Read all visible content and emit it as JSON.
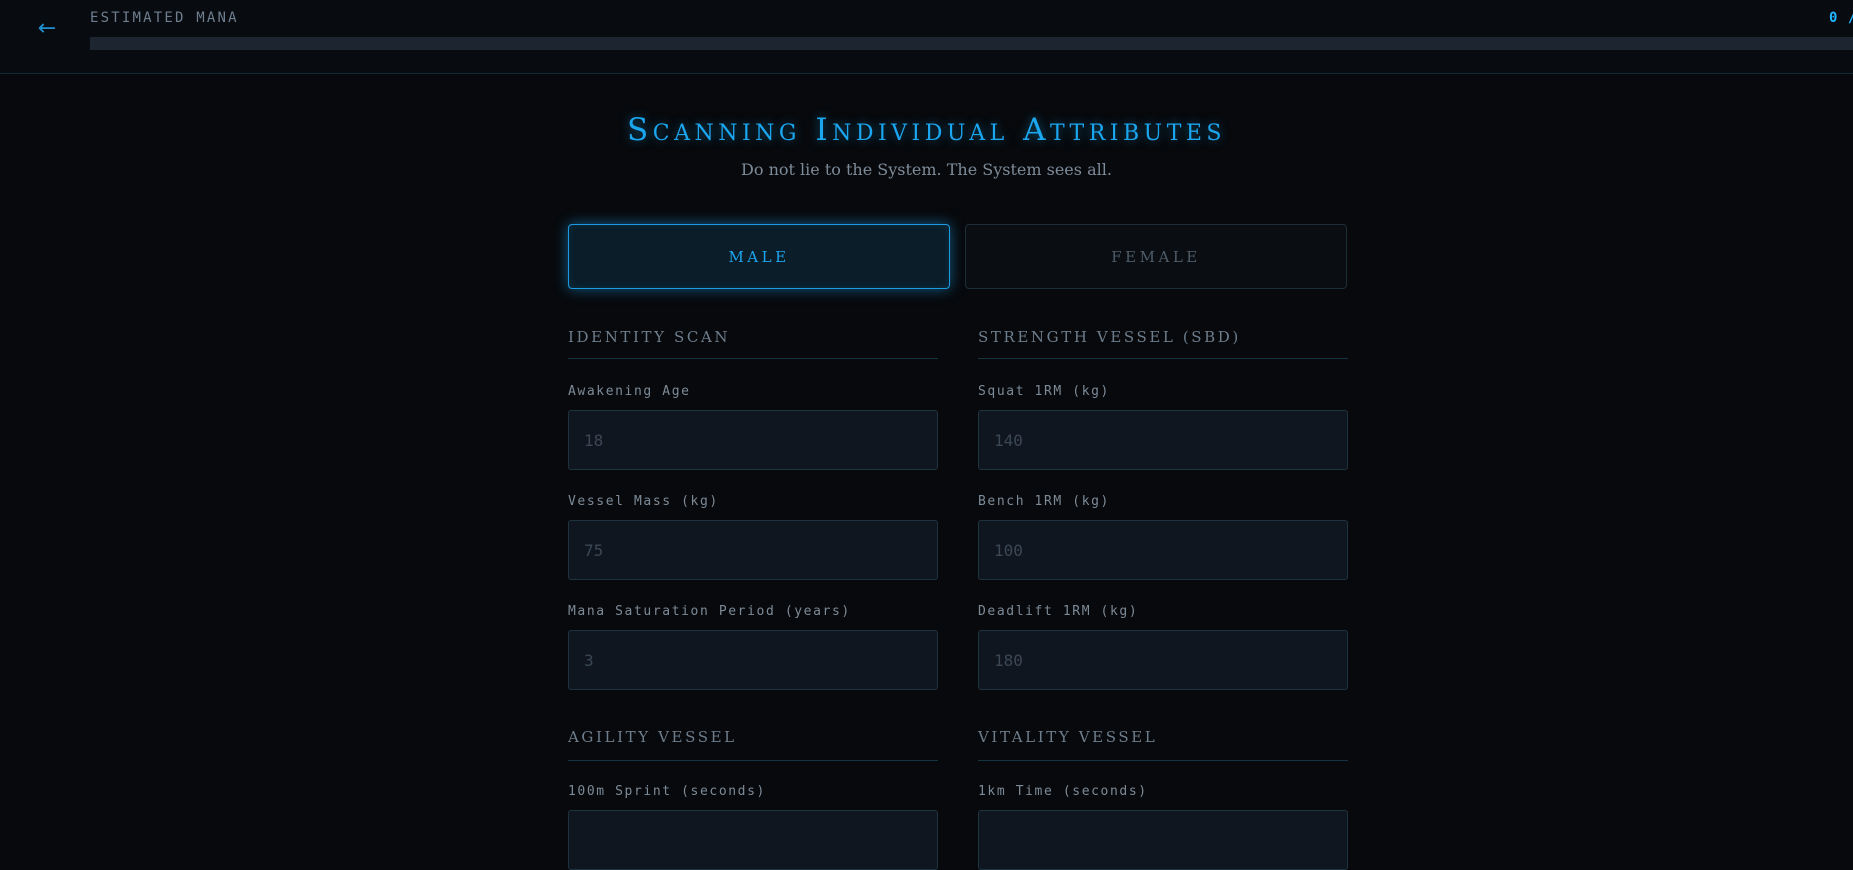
{
  "header": {
    "back_glyph": "←",
    "mana_label": "ESTIMATED MANA",
    "mana_value": "0 /",
    "mana_progress": 0
  },
  "title": "Scanning Individual Attributes",
  "subtitle": "Do not lie to the System. The System sees all.",
  "gender": {
    "male_label": "MALE",
    "female_label": "FEMALE",
    "selected": "MALE"
  },
  "sections": {
    "identity": {
      "title": "IDENTITY SCAN",
      "age": {
        "label": "Awakening Age",
        "value": "",
        "placeholder": "18"
      },
      "mass": {
        "label": "Vessel Mass (kg)",
        "value": "",
        "placeholder": "75"
      },
      "period": {
        "label": "Mana Saturation Period (years)",
        "value": "",
        "placeholder": "3"
      }
    },
    "strength": {
      "title": "STRENGTH VESSEL (SBD)",
      "squat": {
        "label": "Squat 1RM (kg)",
        "value": "",
        "placeholder": "140"
      },
      "bench": {
        "label": "Bench 1RM (kg)",
        "value": "",
        "placeholder": "100"
      },
      "deadlift": {
        "label": "Deadlift 1RM (kg)",
        "value": "",
        "placeholder": "180"
      }
    },
    "agility": {
      "title": "AGILITY VESSEL",
      "sprint": {
        "label": "100m Sprint (seconds)"
      }
    },
    "vitality": {
      "title": "VITALITY VESSEL",
      "run": {
        "label": "1km Time (seconds)"
      }
    }
  },
  "colors": {
    "accent": "#1ba6f0",
    "background": "#07090c",
    "input_bg": "#101620"
  }
}
